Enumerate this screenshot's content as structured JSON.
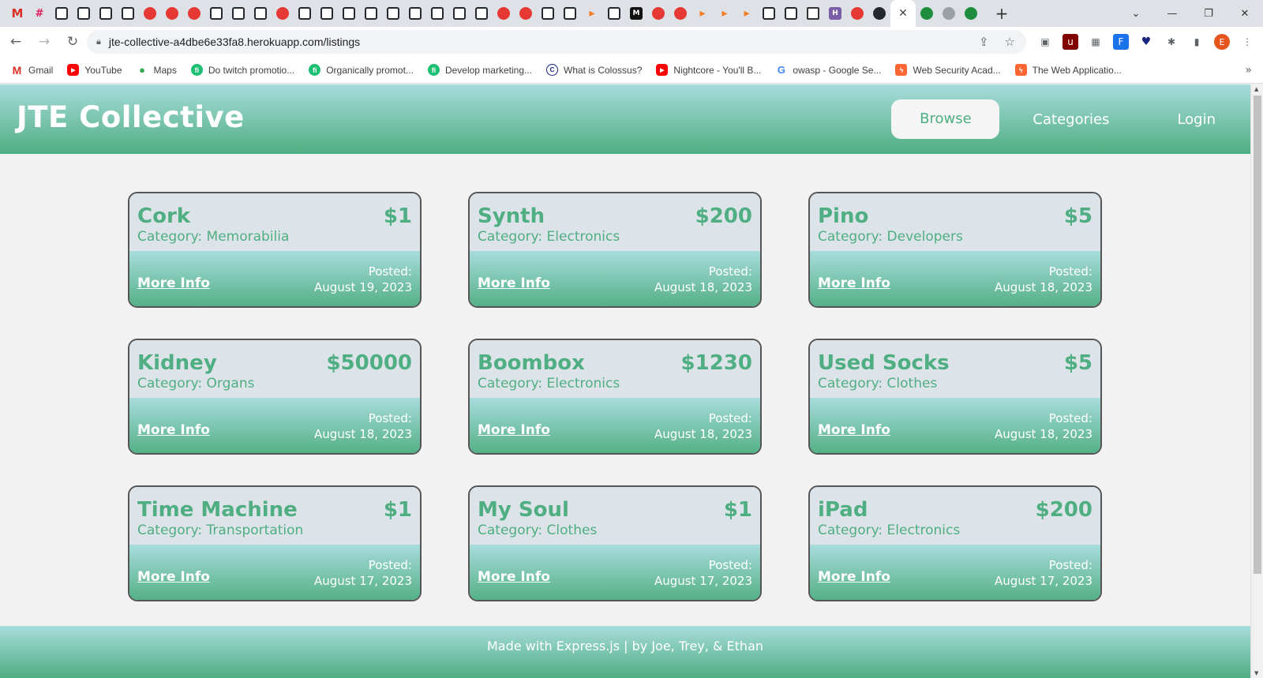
{
  "browser": {
    "tabs": [
      {
        "icon": "gmail-icon",
        "glyph": "M",
        "kind": "gmail"
      },
      {
        "icon": "slack-icon",
        "glyph": "#",
        "kind": "slack"
      },
      {
        "icon": "github-icon",
        "glyph": "",
        "kind": "gh-box"
      },
      {
        "icon": "github-icon",
        "glyph": "",
        "kind": "gh-box"
      },
      {
        "icon": "github-icon",
        "glyph": "",
        "kind": "gh-box"
      },
      {
        "icon": "github-icon",
        "glyph": "",
        "kind": "gh-box"
      },
      {
        "icon": "red-circle-icon",
        "glyph": "",
        "kind": "red"
      },
      {
        "icon": "red-circle-icon",
        "glyph": "",
        "kind": "red"
      },
      {
        "icon": "red-circle-icon",
        "glyph": "",
        "kind": "red"
      },
      {
        "icon": "github-icon",
        "glyph": "",
        "kind": "gh-box"
      },
      {
        "icon": "github-icon",
        "glyph": "",
        "kind": "gh-box"
      },
      {
        "icon": "github-icon",
        "glyph": "",
        "kind": "gh-box"
      },
      {
        "icon": "red-circle-icon",
        "glyph": "",
        "kind": "red"
      },
      {
        "icon": "github-icon",
        "glyph": "",
        "kind": "gh-box"
      },
      {
        "icon": "github-icon",
        "glyph": "",
        "kind": "gh-box"
      },
      {
        "icon": "github-icon",
        "glyph": "",
        "kind": "gh-box"
      },
      {
        "icon": "github-icon",
        "glyph": "",
        "kind": "gh-box"
      },
      {
        "icon": "github-icon",
        "glyph": "",
        "kind": "gh-box"
      },
      {
        "icon": "github-icon",
        "glyph": "",
        "kind": "gh-box"
      },
      {
        "icon": "github-icon",
        "glyph": "",
        "kind": "gh-box"
      },
      {
        "icon": "github-icon",
        "glyph": "",
        "kind": "gh-box"
      },
      {
        "icon": "github-icon",
        "glyph": "",
        "kind": "gh-box"
      },
      {
        "icon": "red-circle-icon",
        "glyph": "",
        "kind": "red"
      },
      {
        "icon": "red-circle-icon",
        "glyph": "",
        "kind": "red"
      },
      {
        "icon": "github-icon",
        "glyph": "",
        "kind": "gh-box"
      },
      {
        "icon": "github-icon",
        "glyph": "",
        "kind": "gh-box"
      },
      {
        "icon": "orange-arrow-icon",
        "glyph": "▸",
        "kind": "orange"
      },
      {
        "icon": "github-icon",
        "glyph": "",
        "kind": "gh-box"
      },
      {
        "icon": "medium-icon",
        "glyph": "M",
        "kind": "black"
      },
      {
        "icon": "red-circle-icon",
        "glyph": "",
        "kind": "red"
      },
      {
        "icon": "red-circle-icon",
        "glyph": "",
        "kind": "red"
      },
      {
        "icon": "orange-arrow-icon",
        "glyph": "▸",
        "kind": "orange"
      },
      {
        "icon": "orange-arrow-icon",
        "glyph": "▸",
        "kind": "orange"
      },
      {
        "icon": "orange-arrow-icon",
        "glyph": "▸",
        "kind": "orange"
      },
      {
        "icon": "github-icon",
        "glyph": "",
        "kind": "gh-box"
      },
      {
        "icon": "github-icon",
        "glyph": "",
        "kind": "gh-box"
      },
      {
        "icon": "square-icon",
        "glyph": "",
        "kind": "square"
      },
      {
        "icon": "purple-icon",
        "glyph": "H",
        "kind": "purple"
      },
      {
        "icon": "red-circle-icon",
        "glyph": "",
        "kind": "red"
      },
      {
        "icon": "github-icon",
        "glyph": "",
        "kind": "github"
      }
    ],
    "active_tab_icon": "close-icon",
    "trailing_tabs": [
      {
        "icon": "green-circle-icon",
        "glyph": "",
        "kind": "green"
      },
      {
        "icon": "globe-icon",
        "glyph": "",
        "kind": "gray"
      },
      {
        "icon": "green-square-icon",
        "glyph": "",
        "kind": "green"
      }
    ],
    "url": "jte-collective-a4dbe6e33fa8.herokuapp.com/listings",
    "profile_initial": "E"
  },
  "bookmarks": [
    {
      "label": "Gmail",
      "icon": "gmail-icon",
      "kind": "gmail",
      "glyph": "M"
    },
    {
      "label": "YouTube",
      "icon": "youtube-icon",
      "kind": "yt",
      "glyph": "▶"
    },
    {
      "label": "Maps",
      "icon": "maps-pin-icon",
      "kind": "maps",
      "glyph": "●"
    },
    {
      "label": "Do twitch promotio...",
      "icon": "fiverr-icon",
      "kind": "fiverr",
      "glyph": "fi"
    },
    {
      "label": "Organically promot...",
      "icon": "fiverr-icon",
      "kind": "fiverr",
      "glyph": "fi"
    },
    {
      "label": "Develop marketing...",
      "icon": "fiverr-icon",
      "kind": "fiverr",
      "glyph": "fi"
    },
    {
      "label": "What is Colossus?",
      "icon": "colossus-icon",
      "kind": "colossus",
      "glyph": "C"
    },
    {
      "label": "Nightcore - You'll B...",
      "icon": "youtube-icon",
      "kind": "yt",
      "glyph": "▶"
    },
    {
      "label": "owasp - Google Se...",
      "icon": "google-icon",
      "kind": "google",
      "glyph": "G"
    },
    {
      "label": "Web Security Acad...",
      "icon": "portswigger-icon",
      "kind": "portswigger",
      "glyph": "ϟ"
    },
    {
      "label": "The Web Applicatio...",
      "icon": "portswigger-icon",
      "kind": "portswigger",
      "glyph": "ϟ"
    }
  ],
  "site": {
    "title": "JTE Collective",
    "nav": {
      "browse": "Browse",
      "categories": "Categories",
      "login": "Login"
    },
    "footer": "Made with Express.js | by Joe, Trey, & Ethan"
  },
  "listings": [
    {
      "name": "Cork",
      "price": "$1",
      "category": "Category: Memorabilia",
      "more": "More Info",
      "posted_label": "Posted:",
      "posted_date": "August 19, 2023"
    },
    {
      "name": "Synth",
      "price": "$200",
      "category": "Category: Electronics",
      "more": "More Info",
      "posted_label": "Posted:",
      "posted_date": "August 18, 2023"
    },
    {
      "name": "Pino",
      "price": "$5",
      "category": "Category: Developers",
      "more": "More Info",
      "posted_label": "Posted:",
      "posted_date": "August 18, 2023"
    },
    {
      "name": "Kidney",
      "price": "$50000",
      "category": "Category: Organs",
      "more": "More Info",
      "posted_label": "Posted:",
      "posted_date": "August 18, 2023"
    },
    {
      "name": "Boombox",
      "price": "$1230",
      "category": "Category: Electronics",
      "more": "More Info",
      "posted_label": "Posted:",
      "posted_date": "August 18, 2023"
    },
    {
      "name": "Used Socks",
      "price": "$5",
      "category": "Category: Clothes",
      "more": "More Info",
      "posted_label": "Posted:",
      "posted_date": "August 18, 2023"
    },
    {
      "name": "Time Machine",
      "price": "$1",
      "category": "Category: Transportation",
      "more": "More Info",
      "posted_label": "Posted:",
      "posted_date": "August 17, 2023"
    },
    {
      "name": "My Soul",
      "price": "$1",
      "category": "Category: Clothes",
      "more": "More Info",
      "posted_label": "Posted:",
      "posted_date": "August 17, 2023"
    },
    {
      "name": "iPad",
      "price": "$200",
      "category": "Category: Electronics",
      "more": "More Info",
      "posted_label": "Posted:",
      "posted_date": "August 17, 2023"
    }
  ],
  "colors": {
    "accent": "#4fae82",
    "header_top": "#a8dcdc",
    "card_top": "#dde4e9"
  }
}
